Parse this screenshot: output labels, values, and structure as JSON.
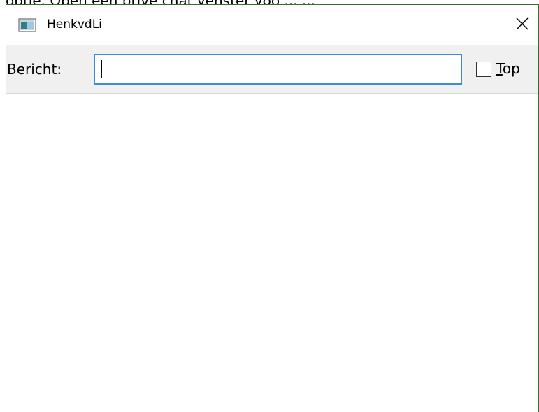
{
  "background": {
    "clipped_text": "optie. Open een prive chat venster voo ... ..."
  },
  "window": {
    "title": "HenkvdLi",
    "icon": "app-window-icon",
    "close_icon": "close-icon"
  },
  "toolbar": {
    "message_label": "Bericht:",
    "message_value": "",
    "top_checkbox": {
      "checked": false,
      "label_mnemonic": "T",
      "label_rest": "op"
    }
  },
  "colors": {
    "input_focus_border": "#3a8ddc",
    "toolbar_bg": "#f0f0f0",
    "window_border": "#3a6b35"
  }
}
